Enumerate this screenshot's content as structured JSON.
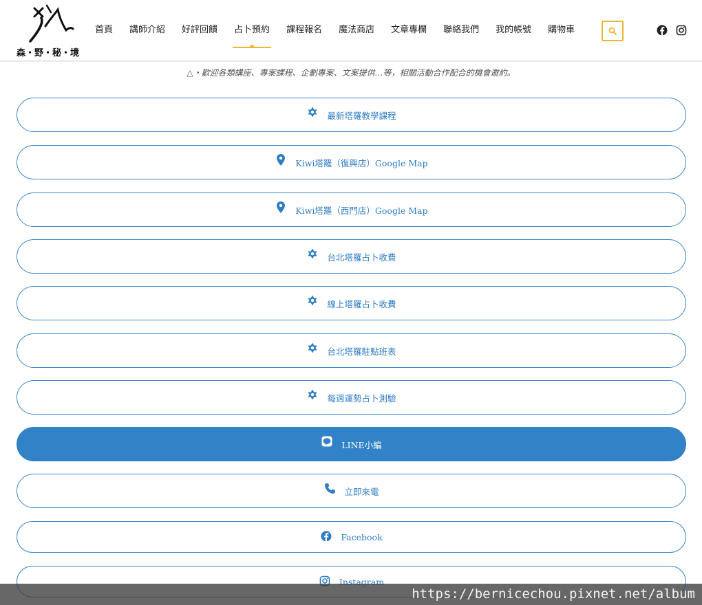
{
  "brand": {
    "logo_text": "森・野・秘・境"
  },
  "nav": [
    {
      "label": "首頁",
      "active": false
    },
    {
      "label": "講師介紹",
      "active": false
    },
    {
      "label": "好評回饋",
      "active": false
    },
    {
      "label": "占卜預約",
      "active": true
    },
    {
      "label": "課程報名",
      "active": false
    },
    {
      "label": "魔法商店",
      "active": false
    },
    {
      "label": "文章專欄",
      "active": false
    },
    {
      "label": "聯絡我們",
      "active": false
    },
    {
      "label": "我的帳號",
      "active": false
    },
    {
      "label": "購物車",
      "active": false
    }
  ],
  "header_icons": {
    "search": "search-icon",
    "facebook": "facebook-icon",
    "instagram": "instagram-icon"
  },
  "notice": "△・歡迎各類講座、專案課程、企劃專案、文案提供…等，相關活動合作配合的機會邀約。",
  "buttons": [
    {
      "label": "最新塔羅教學課程",
      "icon": "star-of-david-icon"
    },
    {
      "label": "Kiwi塔羅（復興店）Google Map",
      "icon": "map-pin-icon"
    },
    {
      "label": "Kiwi塔羅（西門店）Google Map",
      "icon": "map-pin-icon"
    },
    {
      "label": "台北塔羅占卜收費",
      "icon": "star-of-david-icon"
    },
    {
      "label": "線上塔羅占卜收費",
      "icon": "star-of-david-icon"
    },
    {
      "label": "台北塔羅駐點班表",
      "icon": "star-of-david-icon"
    },
    {
      "label": "每週運勢占卜測驗",
      "icon": "star-of-david-icon"
    },
    {
      "label": "LINE小編",
      "icon": "line-icon",
      "filled": true
    },
    {
      "label": "立即來電",
      "icon": "phone-icon"
    },
    {
      "label": "Facebook",
      "icon": "facebook-icon"
    },
    {
      "label": "Instagram",
      "icon": "instagram-icon"
    }
  ],
  "colors": {
    "accent": "#e8b832",
    "primary": "#3182c6"
  },
  "watermark_url": "https://bernicechou.pixnet.net/album"
}
